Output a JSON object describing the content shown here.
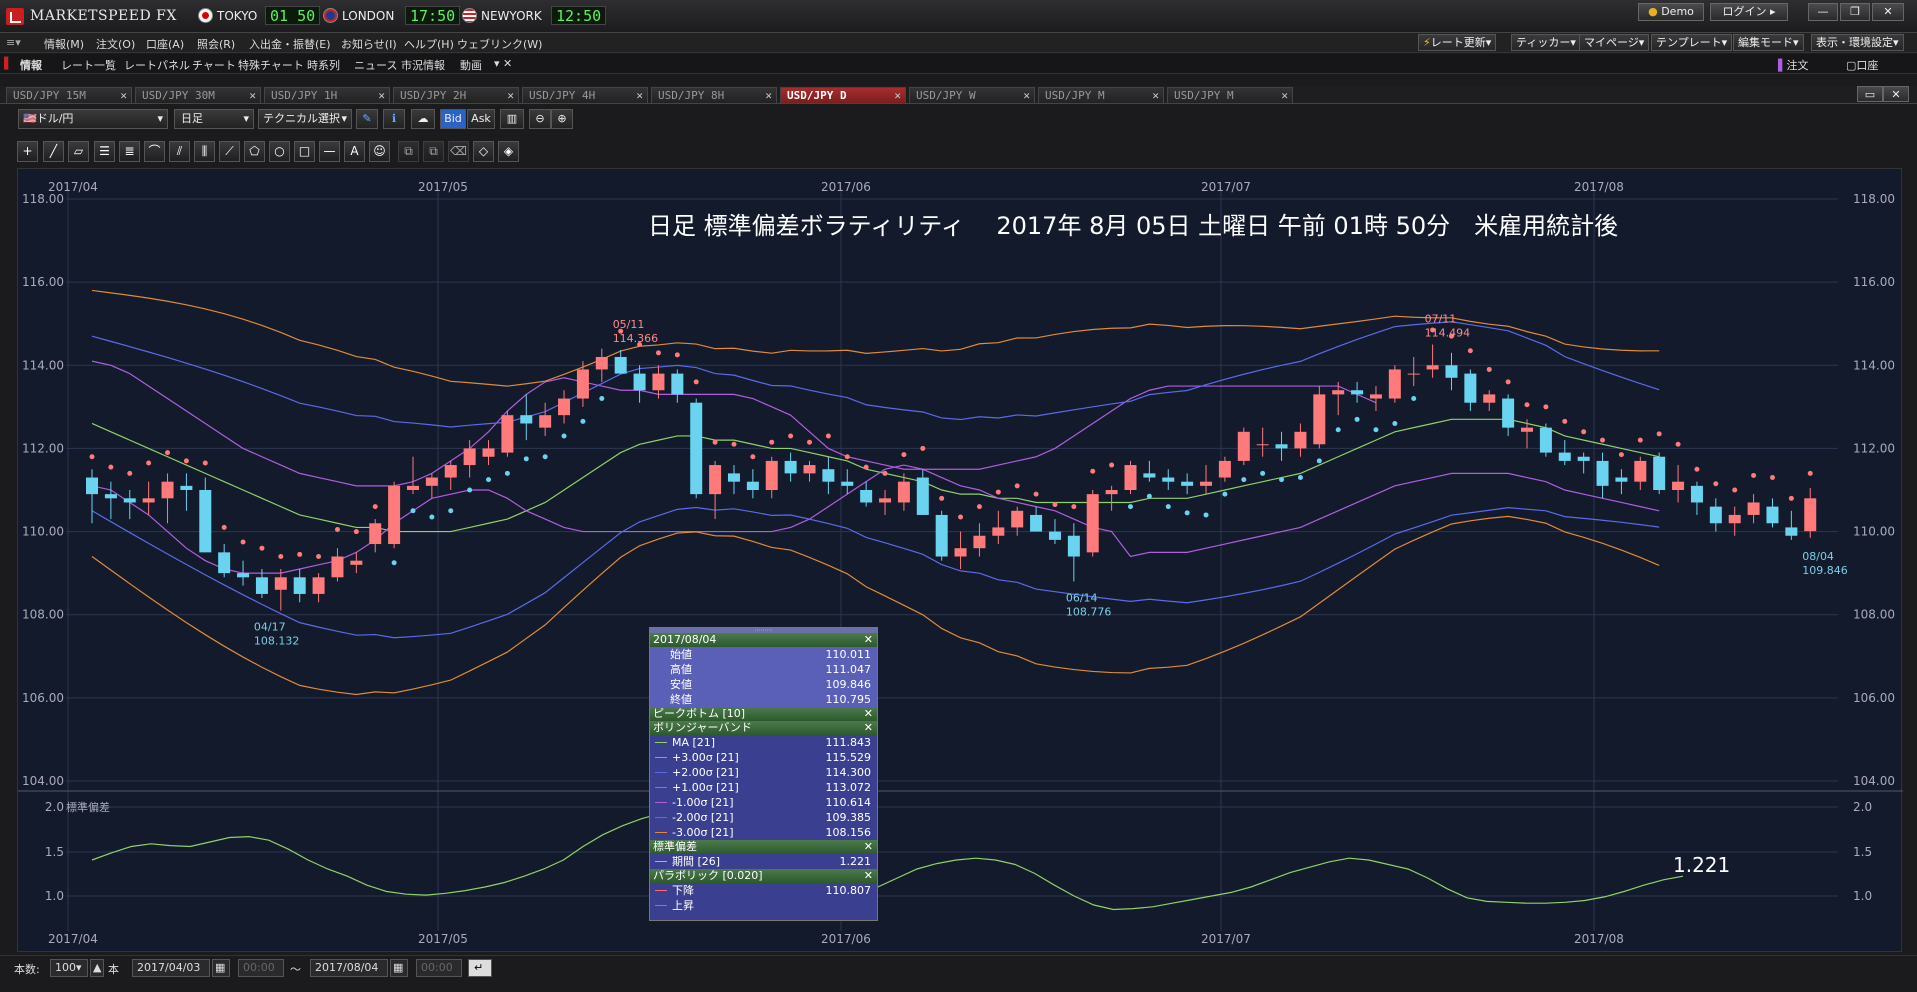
{
  "app": {
    "logo_text": "MARKETSPEED FX",
    "clocks": [
      {
        "city": "TOKYO",
        "time": "01 50"
      },
      {
        "city": "LONDON",
        "time": "17:50"
      },
      {
        "city": "NEWYORK",
        "time": "12:50"
      }
    ],
    "demo_label": "Demo",
    "login_label": "ログイン"
  },
  "menu": {
    "items": [
      "情報(M)",
      "注文(O)",
      "口座(A)",
      "照会(R)",
      "入出金・振替(E)",
      "お知らせ(I)",
      "ヘルプ(H)",
      "ウェブリンク(W)"
    ],
    "right": [
      "レート更新▾",
      "ティッカー▾",
      "マイページ▾",
      "テンプレート▾",
      "編集モード▾",
      "表示・環境設定▾"
    ]
  },
  "nav": {
    "items": [
      "情報",
      "レート一覧",
      "レートパネル",
      "チャート",
      "特殊チャート",
      "時系列",
      "ニュース",
      "市況情報",
      "動画"
    ],
    "order_label": "注文",
    "account_label": "口座"
  },
  "tabs": [
    "USD/JPY 15M",
    "USD/JPY 30M",
    "USD/JPY 1H",
    "USD/JPY 2H",
    "USD/JPY 4H",
    "USD/JPY 8H",
    "USD/JPY D",
    "USD/JPY W",
    "USD/JPY M",
    "USD/JPY M"
  ],
  "active_tab": 6,
  "toolbar": {
    "pair": "ドル/円",
    "timeframe": "日足",
    "technical": "テクニカル選択",
    "bid": "Bid",
    "ask": "Ask"
  },
  "chart": {
    "headline": "日足 標準偏差ボラティリティ　 2017年 8月 05日 土曜日 午前 01時 50分　米雇用統計後",
    "months": [
      "2017/04",
      "2017/05",
      "2017/06",
      "2017/07",
      "2017/08"
    ],
    "y_ticks": [
      "118.00",
      "116.00",
      "114.00",
      "112.00",
      "110.00",
      "108.00",
      "106.00",
      "104.00"
    ],
    "sub_y_ticks": [
      "2.0",
      "1.5",
      "1.0"
    ],
    "sub_label": "標準偏差",
    "sub_value": "1.221",
    "annotations": [
      {
        "date": "05/11",
        "price": "114.366"
      },
      {
        "date": "07/11",
        "price": "114.494"
      },
      {
        "date": "04/17",
        "price": "108.132"
      },
      {
        "date": "06/14",
        "price": "108.776"
      },
      {
        "date": "08/04",
        "price": "109.846"
      }
    ]
  },
  "panel": {
    "date": "2017/08/04",
    "ohlc": [
      {
        "label": "始値",
        "value": "110.011"
      },
      {
        "label": "高値",
        "value": "111.047"
      },
      {
        "label": "安値",
        "value": "109.846"
      },
      {
        "label": "終値",
        "value": "110.795"
      }
    ],
    "peak_bottom": "ピークボトム [10]",
    "bollinger_title": "ボリンジャーバンド",
    "bollinger": [
      {
        "label": "MA [21]",
        "value": "111.843",
        "color": "#8fd16b"
      },
      {
        "label": "+3.00σ [21]",
        "value": "115.529",
        "color": "#e08a3a"
      },
      {
        "label": "+2.00σ [21]",
        "value": "114.300",
        "color": "#5a6be8"
      },
      {
        "label": "+1.00σ [21]",
        "value": "113.072",
        "color": "#b05ee0"
      },
      {
        "label": "-1.00σ [21]",
        "value": "110.614",
        "color": "#b05ee0"
      },
      {
        "label": "-2.00σ [21]",
        "value": "109.385",
        "color": "#5a6be8"
      },
      {
        "label": "-3.00σ [21]",
        "value": "108.156",
        "color": "#e08a3a"
      }
    ],
    "stddev_title": "標準偏差",
    "stddev": {
      "label": "期間 [26]",
      "value": "1.221"
    },
    "parabolic_title": "パラボリック [0.020]",
    "parabolic": [
      {
        "label": "下降",
        "value": "110.807",
        "color": "#ff6a6a"
      },
      {
        "label": "上昇",
        "value": "",
        "color": "#6a7aff"
      }
    ]
  },
  "status": {
    "count_label": "本数:",
    "count": "100",
    "unit": "本",
    "from": "2017/04/03",
    "to": "2017/08/04",
    "from_time": "00:00",
    "to_time": "00:00",
    "tilde": "〜"
  },
  "chart_data": {
    "type": "candlestick",
    "title": "日足 標準偏差ボラティリティ　 2017年 8月 05日 土曜日 午前 01時 50分　米雇用統計後",
    "ylim": [
      104,
      118
    ],
    "candles": [
      [
        111.3,
        111.5,
        110.2,
        110.9
      ],
      [
        110.9,
        111.2,
        110.3,
        110.8
      ],
      [
        110.8,
        111.0,
        110.3,
        110.7
      ],
      [
        110.7,
        111.2,
        110.4,
        110.8
      ],
      [
        110.8,
        111.4,
        110.2,
        111.2
      ],
      [
        111.1,
        111.4,
        110.5,
        111.0
      ],
      [
        111.0,
        111.3,
        109.5,
        109.5
      ],
      [
        109.5,
        109.7,
        108.9,
        109.0
      ],
      [
        109.0,
        109.3,
        108.7,
        108.9
      ],
      [
        108.9,
        109.1,
        108.4,
        108.5
      ],
      [
        108.6,
        109.1,
        108.1,
        108.9
      ],
      [
        108.9,
        109.1,
        108.3,
        108.5
      ],
      [
        108.5,
        109.0,
        108.3,
        108.9
      ],
      [
        108.9,
        109.6,
        108.8,
        109.4
      ],
      [
        109.2,
        109.5,
        109.0,
        109.3
      ],
      [
        109.7,
        110.3,
        109.5,
        110.2
      ],
      [
        109.7,
        111.2,
        109.6,
        111.1
      ],
      [
        111.0,
        111.8,
        110.9,
        111.1
      ],
      [
        111.1,
        111.4,
        110.8,
        111.3
      ],
      [
        111.3,
        111.7,
        111.0,
        111.6
      ],
      [
        111.6,
        112.2,
        111.3,
        112.0
      ],
      [
        111.8,
        112.2,
        111.6,
        112.0
      ],
      [
        111.9,
        112.9,
        111.8,
        112.8
      ],
      [
        112.8,
        113.3,
        112.2,
        112.6
      ],
      [
        112.5,
        113.1,
        112.3,
        112.8
      ],
      [
        112.8,
        113.4,
        112.6,
        113.2
      ],
      [
        113.2,
        114.1,
        113.0,
        113.9
      ],
      [
        113.9,
        114.4,
        113.6,
        114.2
      ],
      [
        114.2,
        114.37,
        113.8,
        113.8
      ],
      [
        113.8,
        114.0,
        113.1,
        113.4
      ],
      [
        113.4,
        114.0,
        113.2,
        113.8
      ],
      [
        113.8,
        113.9,
        113.1,
        113.3
      ],
      [
        113.1,
        113.2,
        110.8,
        110.9
      ],
      [
        110.9,
        111.7,
        110.3,
        111.6
      ],
      [
        111.4,
        111.6,
        110.9,
        111.2
      ],
      [
        111.2,
        111.5,
        110.8,
        111.0
      ],
      [
        111.0,
        111.8,
        110.8,
        111.7
      ],
      [
        111.7,
        111.9,
        111.2,
        111.4
      ],
      [
        111.4,
        111.7,
        111.2,
        111.6
      ],
      [
        111.5,
        111.8,
        110.9,
        111.2
      ],
      [
        111.2,
        111.5,
        110.9,
        111.1
      ],
      [
        111.0,
        111.2,
        110.6,
        110.7
      ],
      [
        110.7,
        111.0,
        110.4,
        110.8
      ],
      [
        110.7,
        111.4,
        110.5,
        111.2
      ],
      [
        111.3,
        111.5,
        110.4,
        110.4
      ],
      [
        110.4,
        110.5,
        109.3,
        109.4
      ],
      [
        109.4,
        110.0,
        109.1,
        109.6
      ],
      [
        109.6,
        110.2,
        109.4,
        109.9
      ],
      [
        109.9,
        110.5,
        109.7,
        110.1
      ],
      [
        110.1,
        110.6,
        109.9,
        110.5
      ],
      [
        110.4,
        110.6,
        110.0,
        110.0
      ],
      [
        110.0,
        110.3,
        109.7,
        109.8
      ],
      [
        109.9,
        110.2,
        108.8,
        109.4
      ],
      [
        109.5,
        111.0,
        109.4,
        110.9
      ],
      [
        110.9,
        111.1,
        110.5,
        111.0
      ],
      [
        111.0,
        111.7,
        110.9,
        111.6
      ],
      [
        111.4,
        111.7,
        111.2,
        111.3
      ],
      [
        111.3,
        111.5,
        111.0,
        111.2
      ],
      [
        111.2,
        111.4,
        110.9,
        111.1
      ],
      [
        111.1,
        111.6,
        110.9,
        111.2
      ],
      [
        111.3,
        111.8,
        111.2,
        111.7
      ],
      [
        111.7,
        112.5,
        111.6,
        112.4
      ],
      [
        112.1,
        112.5,
        111.8,
        112.1
      ],
      [
        112.1,
        112.4,
        111.7,
        112.0
      ],
      [
        112.0,
        112.6,
        111.8,
        112.4
      ],
      [
        112.1,
        113.5,
        112.0,
        113.3
      ],
      [
        113.3,
        113.6,
        112.8,
        113.4
      ],
      [
        113.4,
        113.6,
        113.1,
        113.3
      ],
      [
        113.2,
        113.5,
        112.9,
        113.3
      ],
      [
        113.2,
        114.0,
        113.1,
        113.9
      ],
      [
        113.8,
        114.2,
        113.5,
        113.8
      ],
      [
        113.9,
        114.5,
        113.7,
        114.0
      ],
      [
        114.0,
        114.3,
        113.4,
        113.7
      ],
      [
        113.8,
        113.9,
        112.9,
        113.1
      ],
      [
        113.1,
        113.4,
        112.9,
        113.3
      ],
      [
        113.2,
        113.3,
        112.3,
        112.5
      ],
      [
        112.4,
        112.7,
        112.0,
        112.5
      ],
      [
        112.5,
        112.6,
        111.8,
        111.9
      ],
      [
        111.9,
        112.2,
        111.6,
        111.7
      ],
      [
        111.8,
        111.9,
        111.4,
        111.7
      ],
      [
        111.7,
        111.9,
        110.8,
        111.1
      ],
      [
        111.3,
        111.5,
        110.9,
        111.2
      ],
      [
        111.2,
        111.8,
        111.0,
        111.7
      ],
      [
        111.8,
        111.9,
        110.9,
        111.0
      ],
      [
        111.0,
        111.6,
        110.7,
        111.2
      ],
      [
        111.1,
        111.2,
        110.4,
        110.7
      ],
      [
        110.6,
        110.8,
        110.0,
        110.2
      ],
      [
        110.2,
        110.6,
        109.9,
        110.4
      ],
      [
        110.4,
        110.9,
        110.2,
        110.7
      ],
      [
        110.6,
        110.8,
        110.1,
        110.2
      ],
      [
        110.1,
        110.5,
        109.8,
        109.9
      ],
      [
        110.01,
        111.05,
        109.85,
        110.8
      ]
    ],
    "ma": [
      112.6,
      112.4,
      112.2,
      112.0,
      111.8,
      111.6,
      111.4,
      111.2,
      111.0,
      110.8,
      110.6,
      110.4,
      110.3,
      110.2,
      110.1,
      110.1,
      110.0,
      110.0,
      110.0,
      110.0,
      110.1,
      110.2,
      110.3,
      110.5,
      110.7,
      111.0,
      111.3,
      111.6,
      111.9,
      112.1,
      112.2,
      112.3,
      112.3,
      112.2,
      112.2,
      112.1,
      112.0,
      112.0,
      111.9,
      111.8,
      111.7,
      111.5,
      111.4,
      111.3,
      111.2,
      111.0,
      110.9,
      110.9,
      110.8,
      110.8,
      110.7,
      110.7,
      110.7,
      110.7,
      110.7,
      110.7,
      110.8,
      110.8,
      110.8,
      110.9,
      111.0,
      111.1,
      111.2,
      111.3,
      111.4,
      111.6,
      111.8,
      112.0,
      112.2,
      112.4,
      112.5,
      112.6,
      112.7,
      112.7,
      112.7,
      112.7,
      112.6,
      112.5,
      112.3,
      112.2,
      112.1,
      112.0,
      111.9,
      111.8
    ],
    "upper1": [
      114.1,
      114.0,
      113.8,
      113.5,
      113.2,
      112.9,
      112.6,
      112.3,
      112.0,
      111.8,
      111.6,
      111.4,
      111.3,
      111.2,
      111.1,
      111.1,
      111.1,
      111.2,
      111.4,
      111.7,
      112.0,
      112.4,
      112.9,
      113.3,
      113.6,
      113.7,
      113.6,
      113.5,
      113.4,
      113.4,
      113.3,
      113.3,
      113.3,
      113.3,
      113.3,
      113.2,
      113.0,
      112.8,
      112.4,
      112.0,
      111.8,
      111.7,
      111.6,
      111.5,
      111.5,
      111.5,
      111.5,
      111.5,
      111.6,
      111.7,
      111.8,
      112.0,
      112.3,
      112.6,
      112.9,
      113.2,
      113.4,
      113.5,
      113.5,
      113.5,
      113.5,
      113.5,
      113.5,
      113.5,
      113.5,
      113.5,
      113.5,
      113.3,
      113.1
    ],
    "lower1": [
      111.1,
      111.0,
      110.7,
      110.4,
      110.0,
      109.6,
      109.3,
      109.1,
      109.0,
      109.0,
      109.0,
      109.1,
      109.2,
      109.3,
      109.5,
      109.8,
      110.2,
      110.5,
      110.8,
      110.9,
      111.0,
      111.0,
      110.8,
      110.5,
      110.3,
      110.1,
      110.0,
      110.0,
      110.0,
      110.0,
      110.0,
      110.0,
      110.0,
      110.0,
      110.0,
      110.0,
      110.0,
      110.1,
      110.3,
      110.6,
      110.9,
      111.2,
      111.5,
      111.6,
      111.5,
      111.3,
      111.1,
      111.0,
      110.8,
      110.7,
      110.6,
      110.5,
      110.3,
      110.1,
      110.0
    ]
  }
}
